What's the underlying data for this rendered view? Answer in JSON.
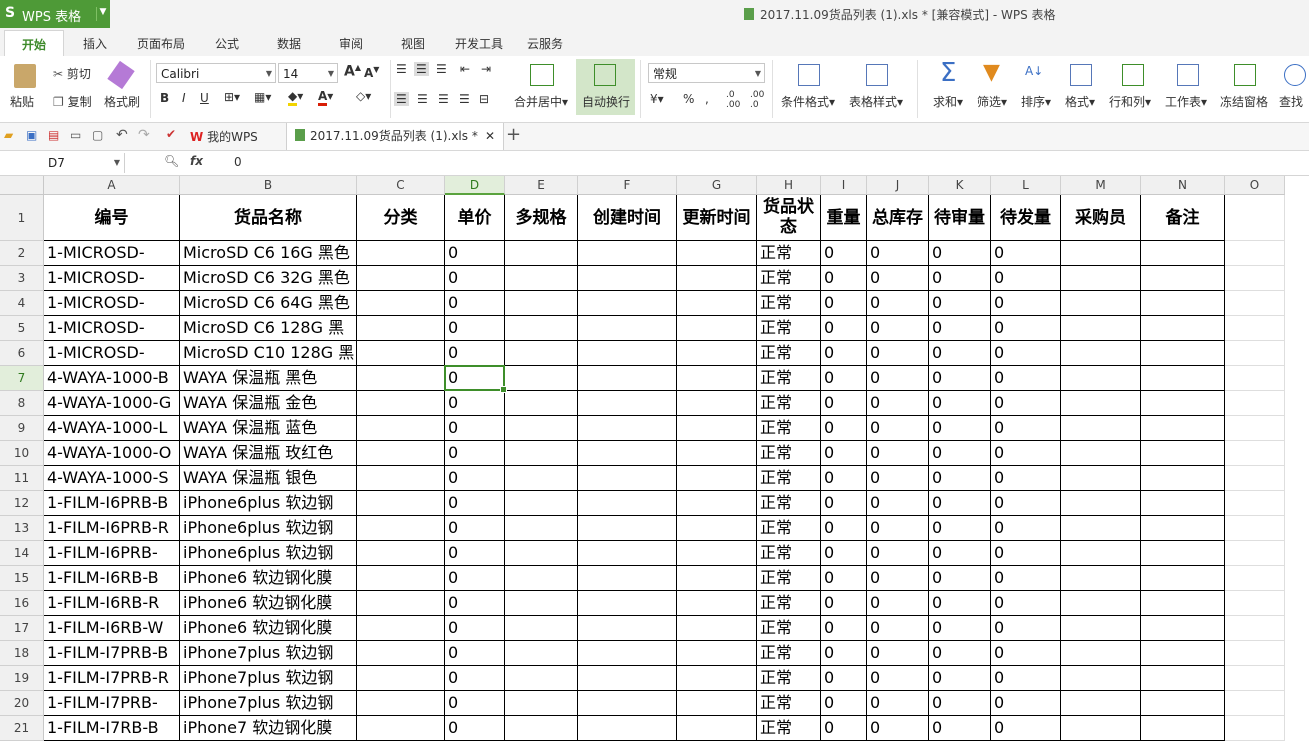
{
  "app": {
    "logo": "S",
    "name": "WPS 表格",
    "window_title": "2017.11.09货品列表 (1).xls * [兼容模式] - WPS 表格"
  },
  "ribbon_tabs": [
    "开始",
    "插入",
    "页面布局",
    "公式",
    "数据",
    "审阅",
    "视图",
    "开发工具",
    "云服务"
  ],
  "ribbon": {
    "paste": "粘贴",
    "cut": "剪切",
    "copy": "复制",
    "format_painter": "格式刷",
    "font_name": "Calibri",
    "font_size": "14",
    "merge_center": "合并居中",
    "wrap_text": "自动换行",
    "number_format": "常规",
    "conditional_format": "条件格式",
    "table_style": "表格样式",
    "sum": "求和",
    "filter": "筛选",
    "sort": "排序",
    "format": "格式",
    "rows_cols": "行和列",
    "worksheet": "工作表",
    "freeze": "冻结窗格",
    "find": "查找"
  },
  "doc_tabs": {
    "my_wps": "我的WPS",
    "file": "2017.11.09货品列表 (1).xls *"
  },
  "formula_bar": {
    "cell_ref": "D7",
    "fx": "fx",
    "value": "0"
  },
  "colors": {
    "accent": "#3e8e2a",
    "app_green": "#4e9a37"
  },
  "columns": [
    "A",
    "B",
    "C",
    "D",
    "E",
    "F",
    "G",
    "H",
    "I",
    "J",
    "K",
    "L",
    "M",
    "N",
    "O"
  ],
  "header_row": [
    "编号",
    "货品名称",
    "分类",
    "单价",
    "多规格",
    "创建时间",
    "更新时间",
    "货品状态",
    "重量",
    "总库存",
    "待审量",
    "待发量",
    "采购员",
    "备注",
    ""
  ],
  "rows": [
    [
      "1-MICROSD-",
      "MicroSD C6 16G 黑色",
      "",
      "0",
      "",
      "",
      "",
      "正常",
      "0",
      "0",
      "0",
      "0",
      "",
      "",
      ""
    ],
    [
      "1-MICROSD-",
      "MicroSD C6 32G 黑色",
      "",
      "0",
      "",
      "",
      "",
      "正常",
      "0",
      "0",
      "0",
      "0",
      "",
      "",
      ""
    ],
    [
      "1-MICROSD-",
      "MicroSD C6 64G 黑色",
      "",
      "0",
      "",
      "",
      "",
      "正常",
      "0",
      "0",
      "0",
      "0",
      "",
      "",
      ""
    ],
    [
      "1-MICROSD-",
      "MicroSD C6 128G 黑",
      "",
      "0",
      "",
      "",
      "",
      "正常",
      "0",
      "0",
      "0",
      "0",
      "",
      "",
      ""
    ],
    [
      "1-MICROSD-",
      "MicroSD C10 128G 黑",
      "",
      "0",
      "",
      "",
      "",
      "正常",
      "0",
      "0",
      "0",
      "0",
      "",
      "",
      ""
    ],
    [
      "4-WAYA-1000-B",
      "WAYA 保温瓶 黑色",
      "",
      "0",
      "",
      "",
      "",
      "正常",
      "0",
      "0",
      "0",
      "0",
      "",
      "",
      ""
    ],
    [
      "4-WAYA-1000-G",
      "WAYA 保温瓶 金色",
      "",
      "0",
      "",
      "",
      "",
      "正常",
      "0",
      "0",
      "0",
      "0",
      "",
      "",
      ""
    ],
    [
      "4-WAYA-1000-L",
      "WAYA 保温瓶 蓝色",
      "",
      "0",
      "",
      "",
      "",
      "正常",
      "0",
      "0",
      "0",
      "0",
      "",
      "",
      ""
    ],
    [
      "4-WAYA-1000-O",
      "WAYA 保温瓶 玫红色",
      "",
      "0",
      "",
      "",
      "",
      "正常",
      "0",
      "0",
      "0",
      "0",
      "",
      "",
      ""
    ],
    [
      "4-WAYA-1000-S",
      "WAYA 保温瓶 银色",
      "",
      "0",
      "",
      "",
      "",
      "正常",
      "0",
      "0",
      "0",
      "0",
      "",
      "",
      ""
    ],
    [
      "1-FILM-I6PRB-B",
      "iPhone6plus 软边钢",
      "",
      "0",
      "",
      "",
      "",
      "正常",
      "0",
      "0",
      "0",
      "0",
      "",
      "",
      ""
    ],
    [
      "1-FILM-I6PRB-R",
      "iPhone6plus 软边钢",
      "",
      "0",
      "",
      "",
      "",
      "正常",
      "0",
      "0",
      "0",
      "0",
      "",
      "",
      ""
    ],
    [
      "1-FILM-I6PRB-",
      "iPhone6plus 软边钢",
      "",
      "0",
      "",
      "",
      "",
      "正常",
      "0",
      "0",
      "0",
      "0",
      "",
      "",
      ""
    ],
    [
      "1-FILM-I6RB-B",
      "iPhone6 软边钢化膜",
      "",
      "0",
      "",
      "",
      "",
      "正常",
      "0",
      "0",
      "0",
      "0",
      "",
      "",
      ""
    ],
    [
      "1-FILM-I6RB-R",
      "iPhone6 软边钢化膜",
      "",
      "0",
      "",
      "",
      "",
      "正常",
      "0",
      "0",
      "0",
      "0",
      "",
      "",
      ""
    ],
    [
      "1-FILM-I6RB-W",
      "iPhone6 软边钢化膜",
      "",
      "0",
      "",
      "",
      "",
      "正常",
      "0",
      "0",
      "0",
      "0",
      "",
      "",
      ""
    ],
    [
      "1-FILM-I7PRB-B",
      "iPhone7plus 软边钢",
      "",
      "0",
      "",
      "",
      "",
      "正常",
      "0",
      "0",
      "0",
      "0",
      "",
      "",
      ""
    ],
    [
      "1-FILM-I7PRB-R",
      "iPhone7plus 软边钢",
      "",
      "0",
      "",
      "",
      "",
      "正常",
      "0",
      "0",
      "0",
      "0",
      "",
      "",
      ""
    ],
    [
      "1-FILM-I7PRB-",
      "iPhone7plus 软边钢",
      "",
      "0",
      "",
      "",
      "",
      "正常",
      "0",
      "0",
      "0",
      "0",
      "",
      "",
      ""
    ],
    [
      "1-FILM-I7RB-B",
      "iPhone7 软边钢化膜",
      "",
      "0",
      "",
      "",
      "",
      "正常",
      "0",
      "0",
      "0",
      "0",
      "",
      "",
      ""
    ]
  ]
}
